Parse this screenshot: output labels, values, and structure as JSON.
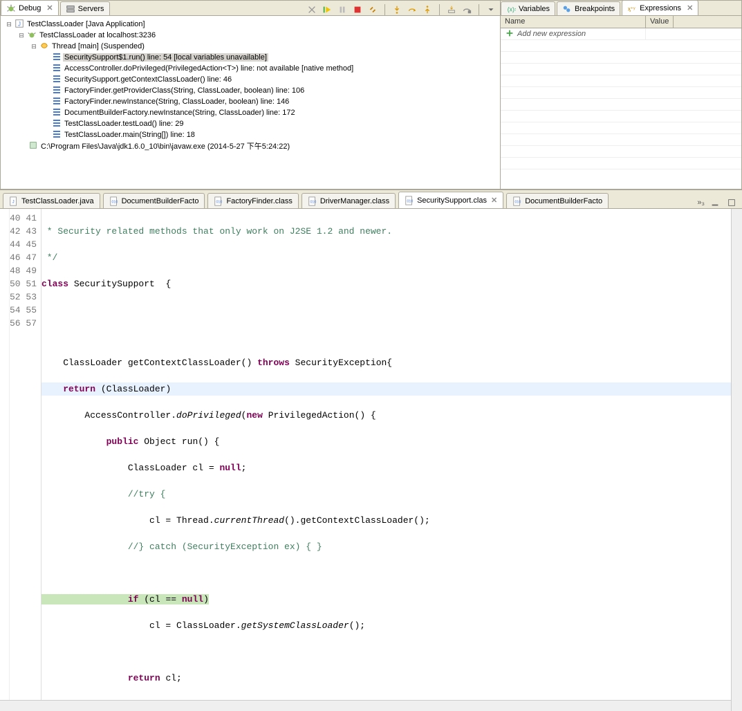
{
  "topTabs": {
    "debug": "Debug",
    "servers": "Servers"
  },
  "debugTree": {
    "root": "TestClassLoader [Java Application]",
    "process": "TestClassLoader at localhost:3236",
    "thread": "Thread [main] (Suspended)",
    "frames": [
      "SecuritySupport$1.run() line: 54 [local variables unavailable]",
      "AccessController.doPrivileged(PrivilegedAction<T>) line: not available [native method]",
      "SecuritySupport.getContextClassLoader() line: 46",
      "FactoryFinder.getProviderClass(String, ClassLoader, boolean) line: 106",
      "FactoryFinder.newInstance(String, ClassLoader, boolean) line: 146",
      "DocumentBuilderFactory.newInstance(String, ClassLoader) line: 172",
      "TestClassLoader.testLoad() line: 29",
      "TestClassLoader.main(String[]) line: 18"
    ],
    "jvm": "C:\\Program Files\\Java\\jdk1.6.0_10\\bin\\javaw.exe (2014-5-27 下午5:24:22)"
  },
  "rightTabs": {
    "variables": "Variables",
    "breakpoints": "Breakpoints",
    "expressions": "Expressions"
  },
  "rightTable": {
    "colName": "Name",
    "colValue": "Value",
    "addText": "Add new expression"
  },
  "editorTabs": {
    "t1": "TestClassLoader.java",
    "t2": "DocumentBuilderFacto",
    "t3": "FactoryFinder.class",
    "t4": "DriverManager.class",
    "t5": "SecuritySupport.clas",
    "t6": "DocumentBuilderFacto",
    "more": "»₃"
  },
  "code": {
    "startLine": 40,
    "cm1": " * Security related methods that only work on J2SE 1.2 and newer.",
    "cm2": " */",
    "cls": "class",
    "clsName": " SecuritySupport  {",
    "m1": "    ClassLoader getContextClassLoader() ",
    "kwThrows": "throws",
    "m1b": " SecurityException{",
    "ret": "    return ",
    "retb": "(ClassLoader)",
    "ac": "        AccessController.",
    "doPriv": "doPrivileged",
    "acb": "(",
    "kwNew": "new",
    "acb2": " PrivilegedAction() {",
    "pub": "            public",
    "pubb": " Object run() {",
    "clnull": "                ClassLoader cl = ",
    "kwNull": "null",
    "clnullb": ";",
    "try": "                //try {",
    "cl2": "                    cl = Thread.",
    "ct": "currentThread",
    "cl2b": "().getContextClassLoader();",
    "catch": "                //} catch (SecurityException ex) { }",
    "if": "                if",
    "ifb": " (cl == ",
    "ifc": ")",
    "cl3": "                    cl = ClassLoader.",
    "gscl": "getSystemClassLoader",
    "cl3b": "();",
    "retcl": "                return",
    "retclb": " cl;"
  }
}
